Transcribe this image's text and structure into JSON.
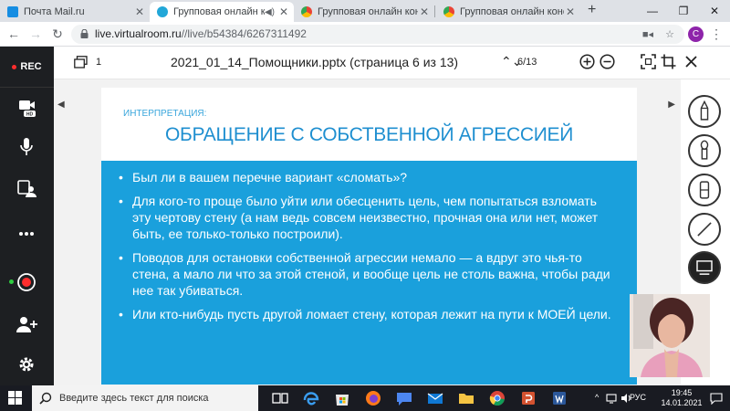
{
  "browser": {
    "tabs": [
      {
        "title": "Почта Mail.ru",
        "icon": "mailru-icon",
        "active": false
      },
      {
        "title": "Групповая онлайн консу",
        "icon": "virtualroom-icon",
        "active": true
      },
      {
        "title": "Групповая онлайн консульт",
        "icon": "chrome-app-icon",
        "active": false
      },
      {
        "title": "Групповая онлайн консульт",
        "icon": "chrome-app-icon",
        "active": false
      }
    ],
    "new_tab": "+",
    "url_host": "live.virtualroom.ru",
    "url_path": "//live/b54384/6267311492",
    "profile_initial": "C"
  },
  "sidebar": {
    "rec_label": "REC",
    "hd_badge": "HD"
  },
  "viewer": {
    "thumb_count": "1",
    "doc_title": "2021_01_14_Помощники.pptx (страница 6 из 13)",
    "page_position": "6/13"
  },
  "slide": {
    "kicker": "ИНТЕРПРЕТАЦИЯ:",
    "title": "ОБРАЩЕНИЕ С СОБСТВЕННОЙ АГРЕССИЕЙ",
    "bullets": [
      "Был ли в вашем перечне вариант «сломать»?",
      "Для кого-то проще было уйти или обесценить цель, чем попытаться взломать эту чертову стену (а нам ведь совсем неизвестно, прочная она или нет, может быть, ее только-только построили).",
      "Поводов для остановки собственной агрессии немало — а вдруг это чья-то стена, а мало ли что за этой стеной, и вообще цель не столь важна, чтобы ради нее так убиваться.",
      "Или кто-нибудь пусть другой ломает стену, которая лежит на пути к МОЕЙ цели."
    ]
  },
  "taskbar": {
    "search_placeholder": "Введите здесь текст для поиска",
    "language": "РУС",
    "time": "19:45",
    "date": "14.01.2021"
  },
  "colors": {
    "slide_blue": "#1aa0dc",
    "title_blue": "#1f8fd0",
    "rec_red": "#ff2d2d",
    "sidebar_bg": "#1d1f22"
  }
}
